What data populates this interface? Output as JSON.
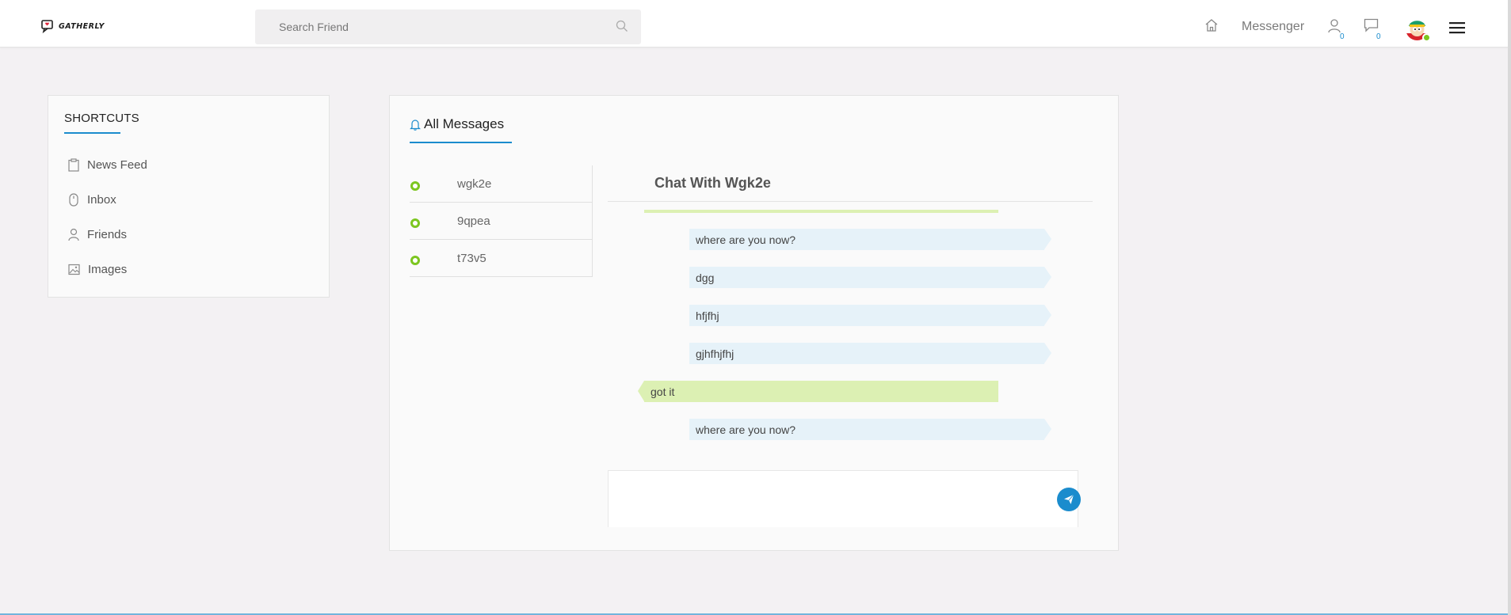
{
  "header": {
    "logo_text": "GATHERLY",
    "search_placeholder": "Search Friend",
    "messenger_label": "Messenger",
    "friend_requests_count": "0",
    "messages_count": "0"
  },
  "sidebar": {
    "title": "SHORTCUTS",
    "items": [
      {
        "label": "News Feed",
        "icon": "clipboard-icon"
      },
      {
        "label": "Inbox",
        "icon": "mouse-icon"
      },
      {
        "label": "Friends",
        "icon": "user-icon"
      },
      {
        "label": "Images",
        "icon": "image-icon"
      }
    ]
  },
  "main": {
    "tab_label": "All Messages",
    "conversations": [
      {
        "name": "wgk2e"
      },
      {
        "name": "9qpea"
      },
      {
        "name": "t73v5"
      }
    ],
    "chat_title": "Chat With Wgk2e",
    "messages": [
      {
        "text": "where are you now?",
        "direction": "out"
      },
      {
        "text": "dgg",
        "direction": "out"
      },
      {
        "text": "hfjfhj",
        "direction": "out"
      },
      {
        "text": "gjhfhjfhj",
        "direction": "out"
      },
      {
        "text": "got it",
        "direction": "in"
      },
      {
        "text": "where are you now?",
        "direction": "out"
      }
    ],
    "composer_value": ""
  },
  "colors": {
    "accent": "#1b8ccd",
    "online": "#7cc620",
    "outgoing_bubble": "#e6f2f9",
    "incoming_bubble": "#dcf0b3",
    "background": "#f3f1f3"
  }
}
